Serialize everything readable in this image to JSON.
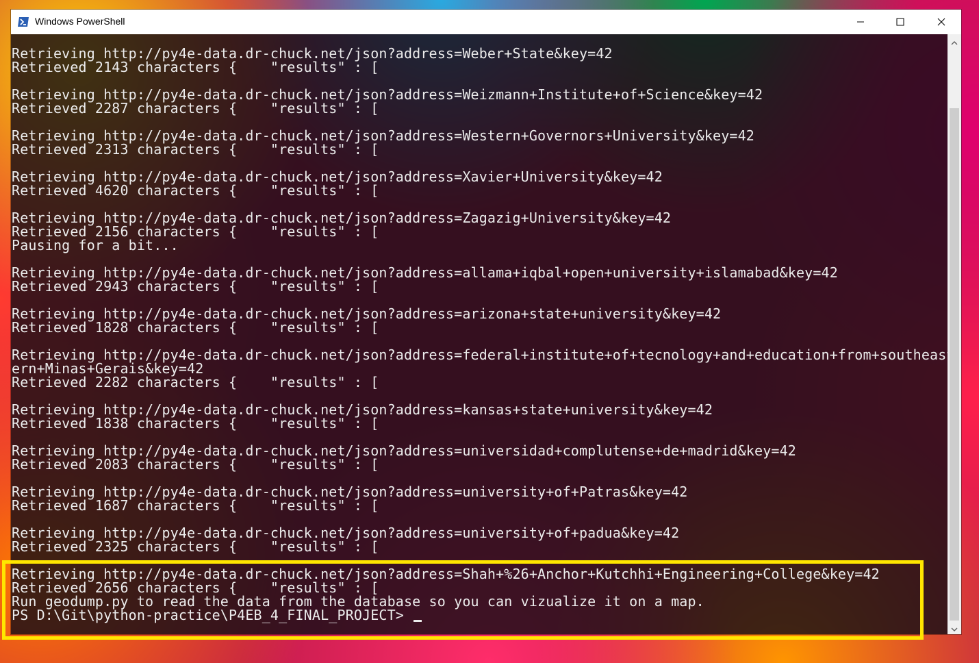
{
  "window": {
    "title": "Windows PowerShell",
    "icon": "powershell-icon"
  },
  "controls": {
    "minimize_icon": "minimize-icon",
    "maximize_icon": "maximize-icon",
    "close_icon": "close-icon"
  },
  "console": {
    "lines": [
      "Retrieving http://py4e-data.dr-chuck.net/json?address=Weber+State&key=42",
      "Retrieved 2143 characters {    \"results\" : [",
      "",
      "Retrieving http://py4e-data.dr-chuck.net/json?address=Weizmann+Institute+of+Science&key=42",
      "Retrieved 2287 characters {    \"results\" : [",
      "",
      "Retrieving http://py4e-data.dr-chuck.net/json?address=Western+Governors+University&key=42",
      "Retrieved 2313 characters {    \"results\" : [",
      "",
      "Retrieving http://py4e-data.dr-chuck.net/json?address=Xavier+University&key=42",
      "Retrieved 4620 characters {    \"results\" : [",
      "",
      "Retrieving http://py4e-data.dr-chuck.net/json?address=Zagazig+University&key=42",
      "Retrieved 2156 characters {    \"results\" : [",
      "Pausing for a bit...",
      "",
      "Retrieving http://py4e-data.dr-chuck.net/json?address=allama+iqbal+open+university+islamabad&key=42",
      "Retrieved 2943 characters {    \"results\" : [",
      "",
      "Retrieving http://py4e-data.dr-chuck.net/json?address=arizona+state+university&key=42",
      "Retrieved 1828 characters {    \"results\" : [",
      "",
      "Retrieving http://py4e-data.dr-chuck.net/json?address=federal+institute+of+tecnology+and+education+from+southeast",
      "ern+Minas+Gerais&key=42",
      "Retrieved 2282 characters {    \"results\" : [",
      "",
      "Retrieving http://py4e-data.dr-chuck.net/json?address=kansas+state+university&key=42",
      "Retrieved 1838 characters {    \"results\" : [",
      "",
      "Retrieving http://py4e-data.dr-chuck.net/json?address=universidad+complutense+de+madrid&key=42",
      "Retrieved 2083 characters {    \"results\" : [",
      "",
      "Retrieving http://py4e-data.dr-chuck.net/json?address=university+of+Patras&key=42",
      "Retrieved 1687 characters {    \"results\" : [",
      "",
      "Retrieving http://py4e-data.dr-chuck.net/json?address=university+of+padua&key=42",
      "Retrieved 2325 characters {    \"results\" : [",
      "",
      "Retrieving http://py4e-data.dr-chuck.net/json?address=Shah+%26+Anchor+Kutchhi+Engineering+College&key=42",
      "Retrieved 2656 characters {    \"results\" : [",
      "Run geodump.py to read the data from the database so you can vizualize it on a map."
    ],
    "prompt": "PS D:\\Git\\python-practice\\P4EB_4_FINAL_PROJECT> "
  },
  "scrollbar": {
    "up_icon": "scroll-up-arrow-icon",
    "down_icon": "scroll-down-arrow-icon"
  },
  "colors": {
    "console_text": "#ececec",
    "highlight_border": "#ffe600",
    "titlebar_bg": "#ffffff",
    "scrollbar_bg": "#f0f0f0"
  }
}
